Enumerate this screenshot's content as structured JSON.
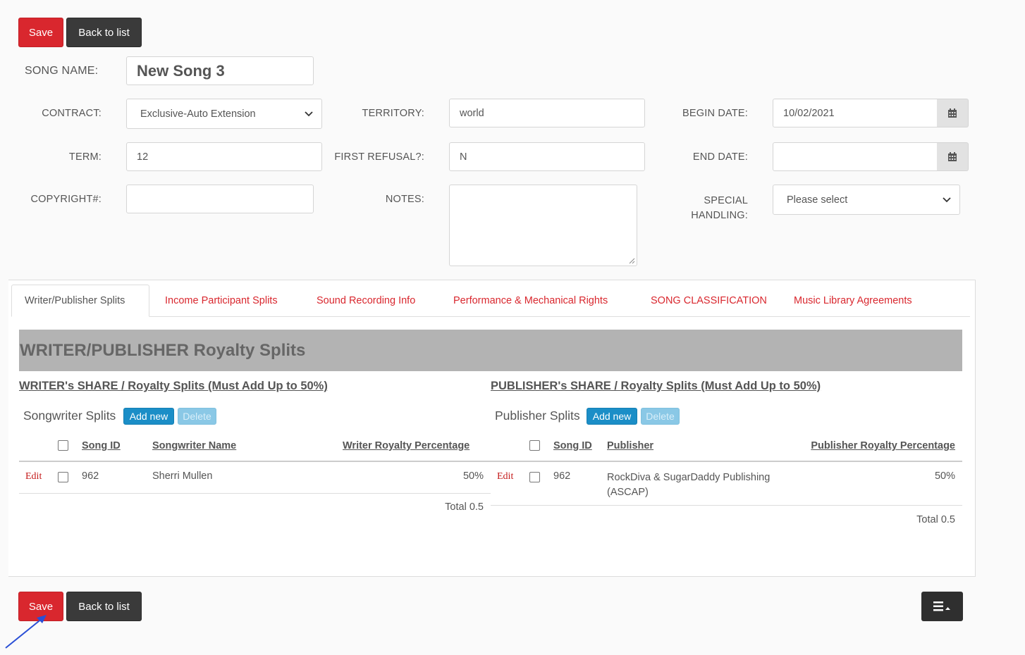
{
  "actions": {
    "save": "Save",
    "back": "Back to list"
  },
  "song": {
    "label": "SONG NAME:",
    "value": "New Song 3"
  },
  "fields": {
    "contract": {
      "label": "CONTRACT:",
      "value": "Exclusive-Auto Extension"
    },
    "territory": {
      "label": "TERRITORY:",
      "value": "world"
    },
    "begin_date": {
      "label": "BEGIN DATE:",
      "value": "10/02/2021"
    },
    "term": {
      "label": "TERM:",
      "value": "12"
    },
    "first_refusal": {
      "label": "FIRST REFUSAL?:",
      "value": "N"
    },
    "end_date": {
      "label": "END DATE:",
      "value": ""
    },
    "copyright": {
      "label": "COPYRIGHT#:",
      "value": ""
    },
    "notes": {
      "label": "NOTES:",
      "value": ""
    },
    "special_handling": {
      "label_line1": "SPECIAL",
      "label_line2": "HANDLING:",
      "value": "Please select"
    }
  },
  "tabs": [
    {
      "label": "Writer/Publisher Splits",
      "active": true
    },
    {
      "label": "Income Participant Splits"
    },
    {
      "label": "Sound Recording Info"
    },
    {
      "label": "Performance & Mechanical Rights"
    },
    {
      "label": "SONG CLASSIFICATION"
    },
    {
      "label": "Music Library Agreements"
    }
  ],
  "panel_title": "WRITER/PUBLISHER Royalty Splits",
  "writer": {
    "heading": "WRITER's SHARE / Royalty Splits (Must Add Up to 50%)",
    "subtitle": "Songwriter Splits",
    "add_label": "Add new",
    "delete_label": "Delete",
    "columns": [
      "Song ID",
      "Songwriter Name",
      "Writer Royalty Percentage"
    ],
    "rows": [
      {
        "edit": "Edit",
        "song_id": "962",
        "name": "Sherri Mullen",
        "percent": "50%"
      }
    ],
    "total": "Total 0.5"
  },
  "publisher": {
    "heading": "PUBLISHER's SHARE / Royalty Splits (Must Add Up to 50%)",
    "subtitle": "Publisher Splits",
    "add_label": "Add new",
    "delete_label": "Delete",
    "columns": [
      "Song ID",
      "Publisher",
      "Publisher Royalty Percentage"
    ],
    "rows": [
      {
        "edit": "Edit",
        "song_id": "962",
        "name_line1": "RockDiva & SugarDaddy Publishing",
        "name_line2": "(ASCAP)",
        "percent": "50%"
      }
    ],
    "total": "Total 0.5"
  },
  "icons": {
    "calendar": "calendar-icon",
    "menu": "menu-caret-icon",
    "dropdown": "chevron-down-icon"
  },
  "colors": {
    "save": "#d9272e",
    "back": "#3a3a3a",
    "tab_link": "#d9272e",
    "add": "#1b8ec7",
    "annotation_arrow": "#2a4fd6"
  }
}
